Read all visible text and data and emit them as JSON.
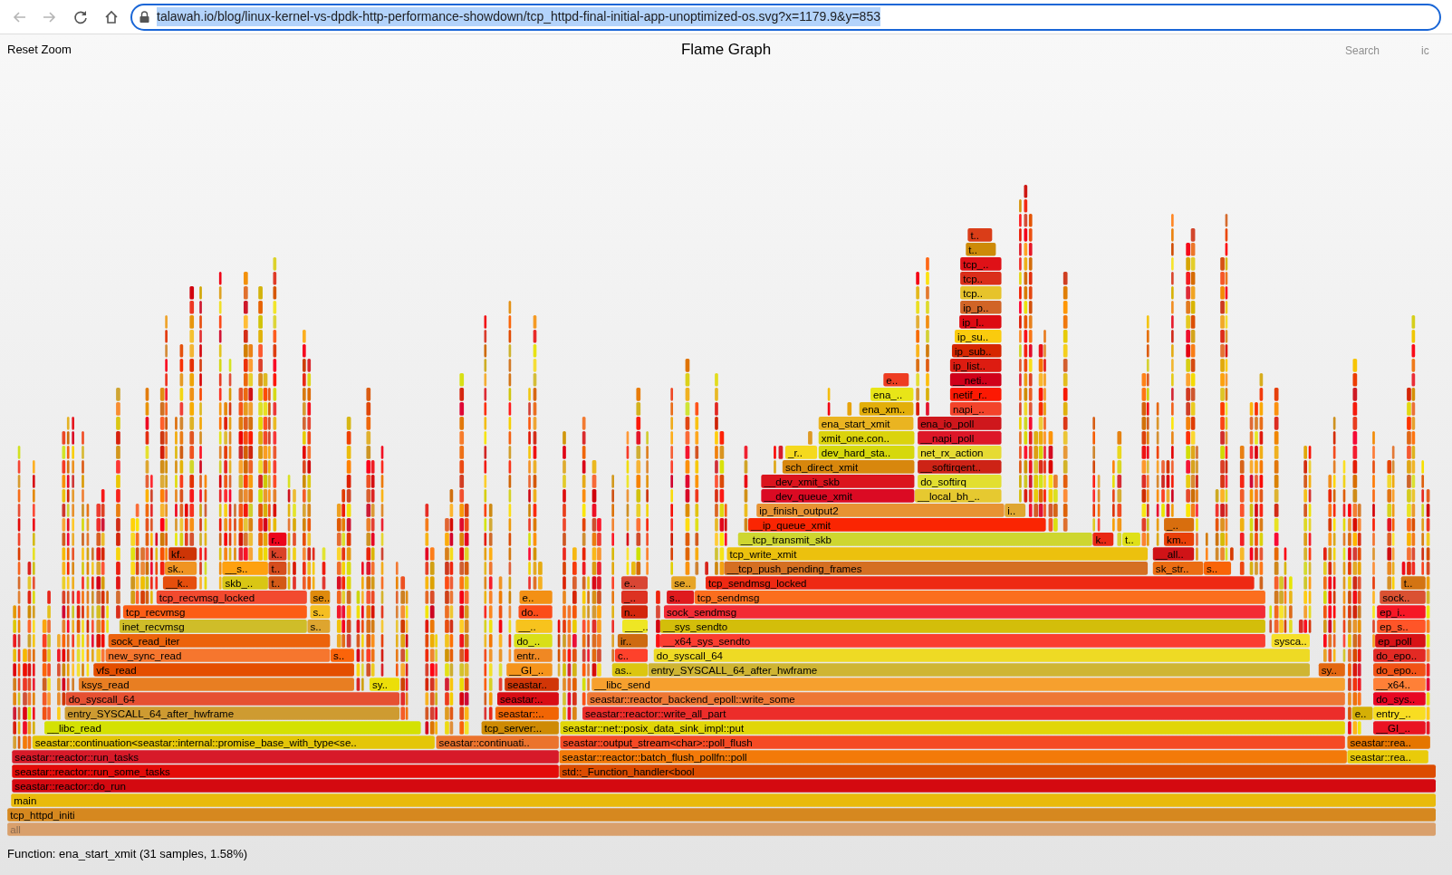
{
  "browser": {
    "url": "talawah.io/blog/linux-kernel-vs-dpdk-http-performance-showdown/tcp_httpd-final-initial-app-unoptimized-os.svg?x=1179.9&y=853",
    "url_selected": true
  },
  "page": {
    "reset_zoom": "Reset Zoom",
    "title": "Flame Graph",
    "search": "Search",
    "ic": "ic"
  },
  "flame_graph": {
    "rows": [
      {
        "frames": [
          {
            "label": "t.."
          }
        ]
      },
      {
        "frames": [
          {
            "label": "t.."
          }
        ]
      },
      {
        "frames": [
          {
            "label": "tcp_.."
          }
        ]
      },
      {
        "frames": [
          {
            "label": "tcp.."
          }
        ]
      },
      {
        "frames": [
          {
            "label": "tcp.."
          }
        ]
      },
      {
        "frames": [
          {
            "label": "ip_p.."
          }
        ]
      },
      {
        "frames": [
          {
            "label": "ip_l.."
          }
        ]
      },
      {
        "frames": [
          {
            "label": "ip_su.."
          }
        ]
      },
      {
        "frames": [
          {
            "label": "ip_sub.."
          }
        ]
      },
      {
        "frames": [
          {
            "label": "ip_list.."
          }
        ]
      },
      {
        "frames": [
          {
            "label": "e.."
          },
          {
            "label": "__neti.."
          }
        ]
      },
      {
        "frames": [
          {
            "label": "ena_.."
          },
          {
            "label": "netif_r.."
          }
        ]
      },
      {
        "frames": [
          {
            "label": "ena_xm.."
          },
          {
            "label": "napi_.."
          }
        ]
      },
      {
        "frames": [
          {
            "label": "ena_start_xmit"
          },
          {
            "label": "ena_io_poll"
          }
        ]
      },
      {
        "frames": [
          {
            "label": "xmit_one.con.."
          },
          {
            "label": "__napi_poll"
          }
        ]
      },
      {
        "frames": [
          {
            "label": "_r.."
          },
          {
            "label": "dev_hard_sta.."
          },
          {
            "label": "net_rx_action"
          }
        ]
      },
      {
        "frames": [
          {
            "label": "sch_direct_xmit"
          },
          {
            "label": "__softirqent.."
          }
        ]
      },
      {
        "frames": [
          {
            "label": "__dev_xmit_skb"
          },
          {
            "label": "do_softirq"
          }
        ]
      },
      {
        "frames": [
          {
            "label": "__dev_queue_xmit"
          },
          {
            "label": "__local_bh_.."
          }
        ]
      },
      {
        "frames": [
          {
            "label": "ip_finish_output2"
          },
          {
            "label": "i.."
          }
        ]
      },
      {
        "frames": [
          {
            "label": "__ip_queue_xmit"
          },
          {
            "label": "_.."
          }
        ]
      },
      {
        "frames": [
          {
            "label": "r.."
          },
          {
            "label": "__tcp_transmit_skb"
          },
          {
            "label": "k.."
          },
          {
            "label": "t.."
          },
          {
            "label": "km.."
          }
        ]
      },
      {
        "frames": [
          {
            "label": "kf.."
          },
          {
            "label": "k.."
          },
          {
            "label": "tcp_write_xmit"
          },
          {
            "label": "__all.."
          }
        ]
      },
      {
        "frames": [
          {
            "label": "sk.."
          },
          {
            "label": "__s.."
          },
          {
            "label": "t.."
          },
          {
            "label": "__tcp_push_pending_frames"
          },
          {
            "label": "sk_str.."
          },
          {
            "label": "s.."
          }
        ]
      },
      {
        "frames": [
          {
            "label": "__k.."
          },
          {
            "label": "skb_.."
          },
          {
            "label": "t.."
          },
          {
            "label": "e.."
          },
          {
            "label": "se.."
          },
          {
            "label": "tcp_sendmsg_locked"
          },
          {
            "label": "t.."
          }
        ]
      },
      {
        "frames": [
          {
            "label": "tcp_recvmsg_locked"
          },
          {
            "label": "se.."
          },
          {
            "label": "e.."
          },
          {
            "label": "_.."
          },
          {
            "label": "s.."
          },
          {
            "label": "tcp_sendmsg"
          },
          {
            "label": "sock.."
          }
        ]
      },
      {
        "frames": [
          {
            "label": "tcp_recvmsg"
          },
          {
            "label": "s.."
          },
          {
            "label": "do.."
          },
          {
            "label": "n.."
          },
          {
            "label": "sock_sendmsg"
          },
          {
            "label": "ep_i.."
          }
        ]
      },
      {
        "frames": [
          {
            "label": "inet_recvmsg"
          },
          {
            "label": "s.."
          },
          {
            "label": "__.."
          },
          {
            "label": "___.."
          },
          {
            "label": "__sys_sendto"
          },
          {
            "label": "ep_s.."
          }
        ]
      },
      {
        "frames": [
          {
            "label": "sock_read_iter"
          },
          {
            "label": "do_.."
          },
          {
            "label": "ir.."
          },
          {
            "label": "__x64_sys_sendto"
          },
          {
            "label": "sysca.."
          },
          {
            "label": "ep_poll"
          }
        ]
      },
      {
        "frames": [
          {
            "label": "new_sync_read"
          },
          {
            "label": "s.."
          },
          {
            "label": "entr.."
          },
          {
            "label": "c.."
          },
          {
            "label": "do_syscall_64"
          },
          {
            "label": "do_epo.."
          }
        ]
      },
      {
        "frames": [
          {
            "label": "vfs_read"
          },
          {
            "label": "__GI_.."
          },
          {
            "label": "as.."
          },
          {
            "label": "entry_SYSCALL_64_after_hwframe"
          },
          {
            "label": "sy.."
          },
          {
            "label": "do_epo.."
          }
        ]
      },
      {
        "frames": [
          {
            "label": "ksys_read"
          },
          {
            "label": "sy.."
          },
          {
            "label": "seastar.."
          },
          {
            "label": "__libc_send"
          },
          {
            "label": "__x64.."
          }
        ]
      },
      {
        "frames": [
          {
            "label": "do_syscall_64"
          },
          {
            "label": "seastar:.."
          },
          {
            "label": "seastar::reactor_backend_epoll::write_some"
          },
          {
            "label": "do_sys.."
          }
        ]
      },
      {
        "frames": [
          {
            "label": "entry_SYSCALL_64_after_hwframe"
          },
          {
            "label": "seastar::.."
          },
          {
            "label": "seastar::reactor::write_all_part"
          },
          {
            "label": "e.."
          },
          {
            "label": "entry_.."
          }
        ]
      },
      {
        "frames": [
          {
            "label": "__libc_read"
          },
          {
            "label": "tcp_server:.."
          },
          {
            "label": "seastar::net::posix_data_sink_impl::put"
          },
          {
            "label": "__GI_.."
          }
        ]
      },
      {
        "frames": [
          {
            "label": "seastar::continuation<seastar::internal::promise_base_with_type<se.."
          },
          {
            "label": "seastar::continuati.."
          },
          {
            "label": "seastar::output_stream<char>::poll_flush"
          },
          {
            "label": "seastar::rea.."
          }
        ]
      },
      {
        "frames": [
          {
            "label": "seastar::reactor::run_tasks"
          },
          {
            "label": "seastar::reactor::batch_flush_pollfn::poll"
          },
          {
            "label": "seastar::rea.."
          }
        ]
      },
      {
        "frames": [
          {
            "label": "seastar::reactor::run_some_tasks"
          },
          {
            "label": "std::_Function_handler<bool"
          }
        ]
      },
      {
        "frames": [
          {
            "label": "seastar::reactor::do_run"
          }
        ]
      },
      {
        "frames": [
          {
            "label": "main"
          }
        ]
      },
      {
        "frames": [
          {
            "label": "tcp_httpd_initi"
          }
        ]
      },
      {
        "frames": [
          {
            "label": "all"
          }
        ]
      }
    ]
  },
  "status": "Function: ena_start_xmit (31 samples, 1.58%)"
}
